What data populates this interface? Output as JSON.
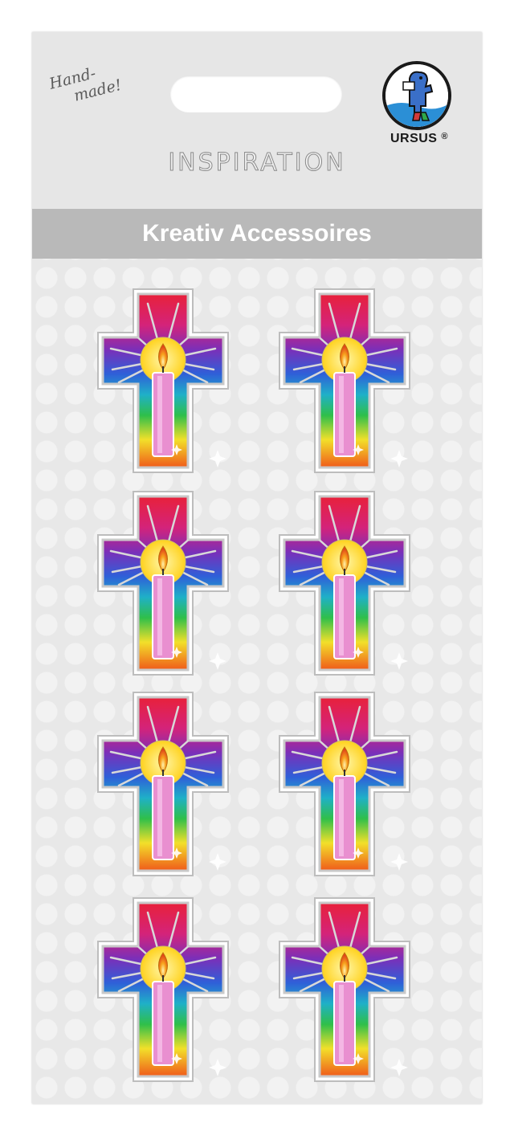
{
  "header": {
    "handmade_line1": "Hand-",
    "handmade_line2": "made!",
    "brand": "URSUS",
    "brand_mark": "®",
    "series": "INSPIRATION"
  },
  "banner": {
    "title": "Kreativ Accessoires"
  },
  "stickers": [
    {
      "icon": "rainbow-cross-candle-icon"
    },
    {
      "icon": "rainbow-cross-candle-icon"
    },
    {
      "icon": "rainbow-cross-candle-icon"
    },
    {
      "icon": "rainbow-cross-candle-icon"
    },
    {
      "icon": "rainbow-cross-candle-icon"
    },
    {
      "icon": "rainbow-cross-candle-icon"
    },
    {
      "icon": "rainbow-cross-candle-icon"
    },
    {
      "icon": "rainbow-cross-candle-icon"
    }
  ],
  "colors": {
    "card": "#e8e8e8",
    "banner": "#b9b9b9",
    "candle": "#e98fd0",
    "halo": "#ffe14a"
  }
}
